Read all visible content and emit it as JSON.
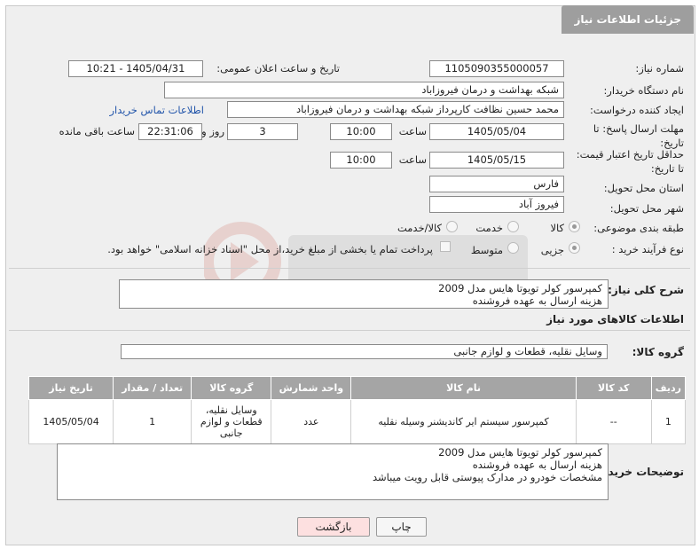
{
  "header": {
    "title": "جزئیات اطلاعات نیاز"
  },
  "fields": {
    "need_number_label": "شماره نیاز:",
    "need_number": "1105090355000057",
    "announce_label": "تاریخ و ساعت اعلان عمومی:",
    "announce_value": "1405/04/31 - 10:21",
    "buyer_org_label": "نام دستگاه خریدار:",
    "buyer_org": "شبکه بهداشت و درمان فیروزاباد",
    "creator_label": "ایجاد کننده درخواست:",
    "creator": "محمد حسین نظافت کارپرداز شبکه بهداشت و درمان فیروزاباد",
    "contact_link": "اطلاعات تماس خریدار",
    "reply_deadline_label_1": "مهلت ارسال پاسخ: تا",
    "reply_deadline_label_2": "تاریخ:",
    "reply_date": "1405/05/04",
    "time_label": "ساعت",
    "reply_time": "10:00",
    "days_value": "3",
    "days_label": "روز و",
    "remaining_time": "22:31:06",
    "remaining_label": "ساعت باقی مانده",
    "price_deadline_label_1": "حداقل تاریخ اعتبار قیمت:",
    "price_deadline_label_2": "تا تاریخ:",
    "price_date": "1405/05/15",
    "price_time": "10:00",
    "province_label": "استان محل تحویل:",
    "province": "فارس",
    "city_label": "شهر محل تحویل:",
    "city": "فیروز آباد",
    "category_label": "طبقه بندی موضوعی:",
    "category_options": [
      "کالا",
      "خدمت",
      "کالا/خدمت"
    ],
    "process_label": "نوع فرآیند خرید :",
    "process_options": [
      "جزیی",
      "متوسط"
    ],
    "payment_note": "پرداخت تمام یا بخشی از مبلغ خرید،از محل \"اسناد خزانه اسلامی\" خواهد بود.",
    "description_label": "شرح کلی نیاز:",
    "description_lines": [
      "کمپرسور کولر تویوتا هایس مدل 2009",
      "هزینه ارسال به عهده فروشنده"
    ],
    "goods_info_title": "اطلاعات کالاهای مورد نیاز",
    "goods_group_label": "گروه کالا:",
    "goods_group": "وسایل نقلیه، قطعات و لوازم جانبی"
  },
  "table": {
    "headers": [
      "ردیف",
      "کد کالا",
      "نام کالا",
      "واحد شمارش",
      "گروه کالا",
      "تعداد / مقدار",
      "تاریخ نیاز"
    ],
    "rows": [
      [
        "1",
        "--",
        "کمپرسور سیستم ایر کاندیشنر وسیله نقلیه",
        "عدد",
        "وسایل نقلیه، قطعات و لوازم جانبی",
        "1",
        "1405/05/04"
      ]
    ]
  },
  "buyer_notes": {
    "label": "توضیحات خریدار:",
    "lines": [
      "کمپرسور کولر تویوتا هایس مدل 2009",
      "هزینه ارسال به عهده فروشنده",
      "مشخصات خودرو در مدارک پیوستی قابل رویت میباشد"
    ]
  },
  "buttons": {
    "print": "چاپ",
    "back": "بازگشت"
  },
  "colors": {
    "tab_bg": "#9e9e9e",
    "table_header_bg": "#a5a5a5",
    "back_button_bg": "#fde0e0",
    "link": "#2255aa"
  }
}
